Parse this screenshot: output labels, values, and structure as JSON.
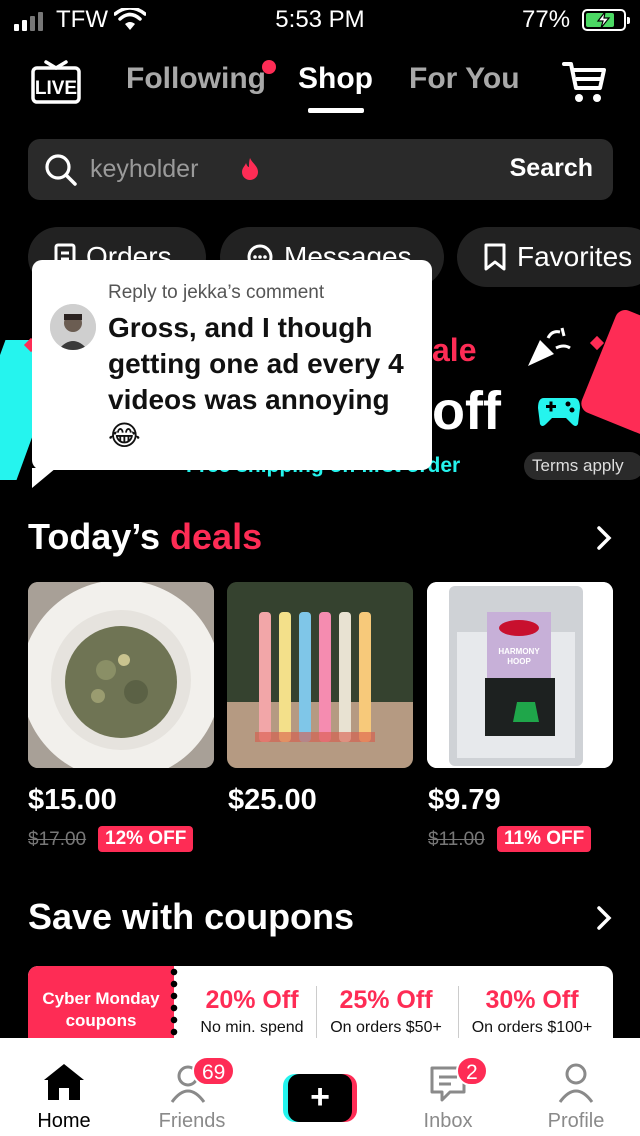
{
  "status_bar": {
    "carrier": "TFW",
    "time": "5:53 PM",
    "battery_percent": "77%",
    "battery_level": 0.77,
    "battery_color": "#4cd964"
  },
  "top_nav": {
    "live_icon": "live-tv-icon",
    "tabs": [
      {
        "label": "Following",
        "has_dot": true
      },
      {
        "label": "Shop",
        "active": true
      },
      {
        "label": "For You"
      }
    ],
    "cart_icon": "cart-icon"
  },
  "search": {
    "placeholder": "keyholder",
    "button_label": "Search"
  },
  "pills": {
    "orders": "Orders",
    "messages": "Messages",
    "favorites": "Favorites"
  },
  "banner": {
    "sale_text": "ale",
    "off_text": "off",
    "free_text": "Free shipping on first order",
    "terms": "Terms apply"
  },
  "reply": {
    "header": "Reply to jekka’s comment",
    "text": "Gross, and I though getting one ad every 4 videos was annoying 😂"
  },
  "deals": {
    "title_a": "Today’s ",
    "title_b": "deals",
    "items": [
      {
        "price": "$15.00",
        "old_price": "$17.00",
        "discount": "12% OFF"
      },
      {
        "price": "$25.00"
      },
      {
        "price": "$9.79",
        "old_price": "$11.00",
        "discount": "11% OFF",
        "pack_label": "HARMONY HOOP"
      }
    ]
  },
  "coupons": {
    "title": "Save with coupons",
    "tag": "Cyber Monday coupons",
    "items": [
      {
        "pct": "20% Off",
        "sub": "No min. spend"
      },
      {
        "pct": "25% Off",
        "sub": "On orders $50+"
      },
      {
        "pct": "30% Off",
        "sub": "On orders $100+"
      }
    ]
  },
  "bottom_nav": {
    "home": "Home",
    "friends": "Friends",
    "friends_badge": "69",
    "create": "+",
    "inbox": "Inbox",
    "inbox_badge": "2",
    "profile": "Profile"
  },
  "colors": {
    "accent_red": "#fe2c55",
    "accent_cyan": "#25f4ee"
  }
}
